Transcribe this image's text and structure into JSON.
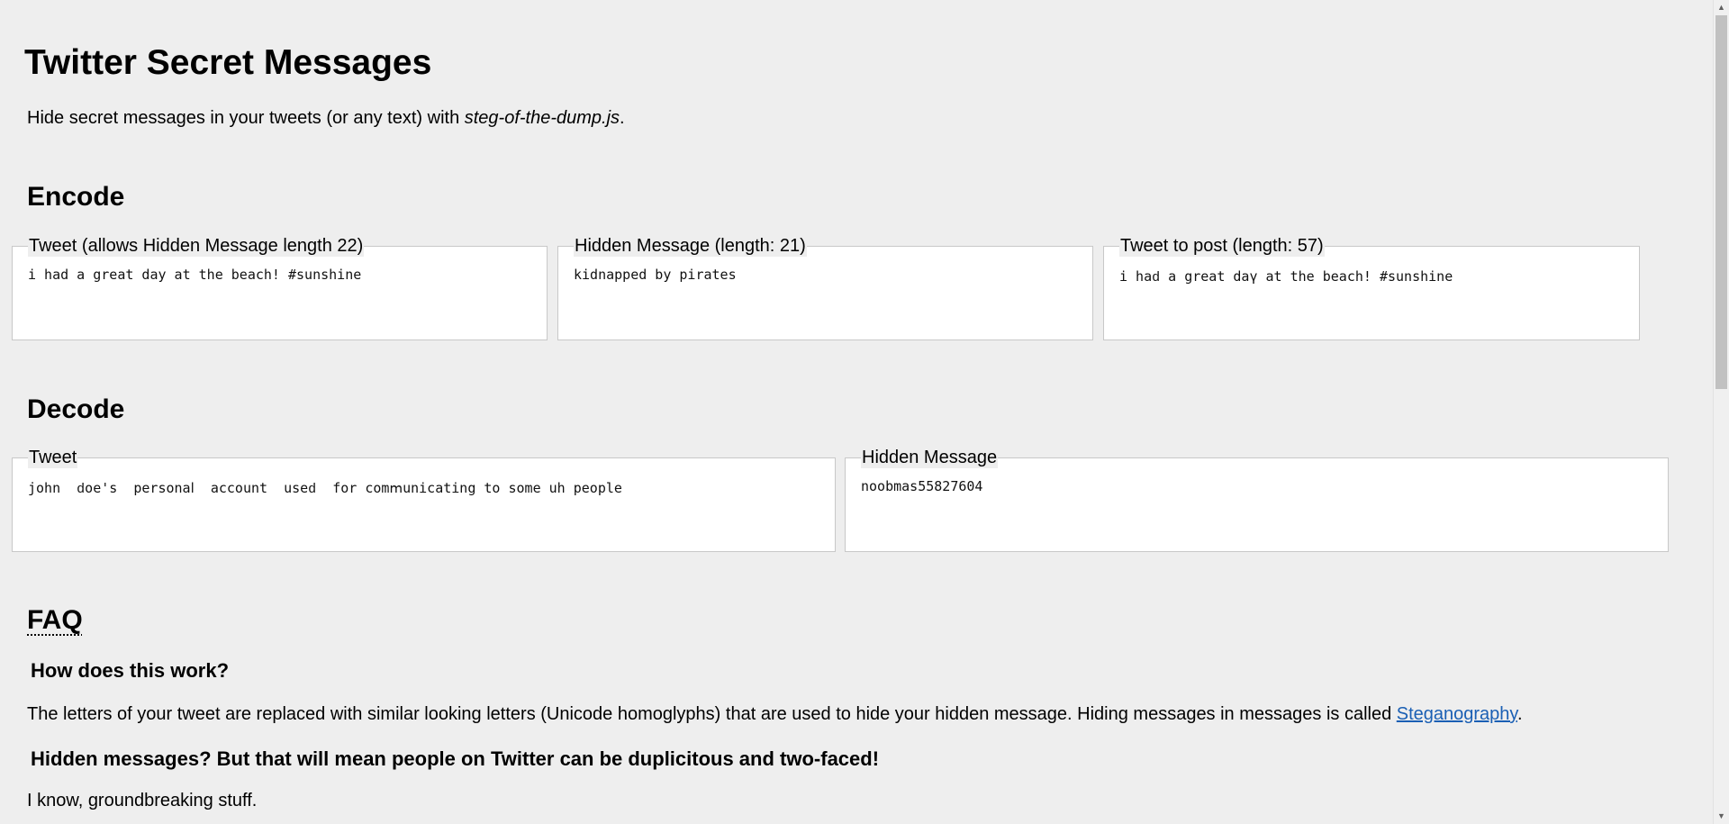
{
  "header": {
    "title": "Twitter Secret Messages",
    "intro_before": "Hide secret messages in your tweets (or any text) with ",
    "intro_lib": "steg-of-the-dump.js",
    "intro_after": "."
  },
  "encode": {
    "heading": "Encode",
    "tweet": {
      "legend": "Tweet (allows Hidden Message length 22)",
      "value": "i had a great day at the beach! #sunshine"
    },
    "hidden_message": {
      "legend": "Hidden Message (length: 21)",
      "value": "kidnapped by pirates"
    },
    "tweet_to_post": {
      "legend": "Tweet to post (length: 57)",
      "value": "i haԁ a grеаt dаү at the bеасh! #sunshіne"
    }
  },
  "decode": {
    "heading": "Decode",
    "tweet": {
      "legend": "Tweet",
      "value": "јоhn  ԁoе's  реrѕonаⅼ  ассouոt  uѕеԁ  for comⅿuոiсаtiոg to some uh people"
    },
    "hidden_message": {
      "legend": "Hidden Message",
      "value": "noobmas55827604"
    }
  },
  "faq": {
    "heading": "FAQ",
    "items": [
      {
        "question": "How does this work?",
        "answer_before": "The letters of your tweet are replaced with similar looking letters (Unicode homoglyphs) that are used to hide your hidden message. Hiding messages in messages is called ",
        "answer_link": "Steganography",
        "answer_after": "."
      },
      {
        "question": "Hidden messages? But that will mean people on Twitter can be duplicitous and two-faced!",
        "answer": "I know, groundbreaking stuff."
      }
    ]
  },
  "scrollbar": {
    "up_icon": "▲",
    "down_icon": "▼"
  }
}
